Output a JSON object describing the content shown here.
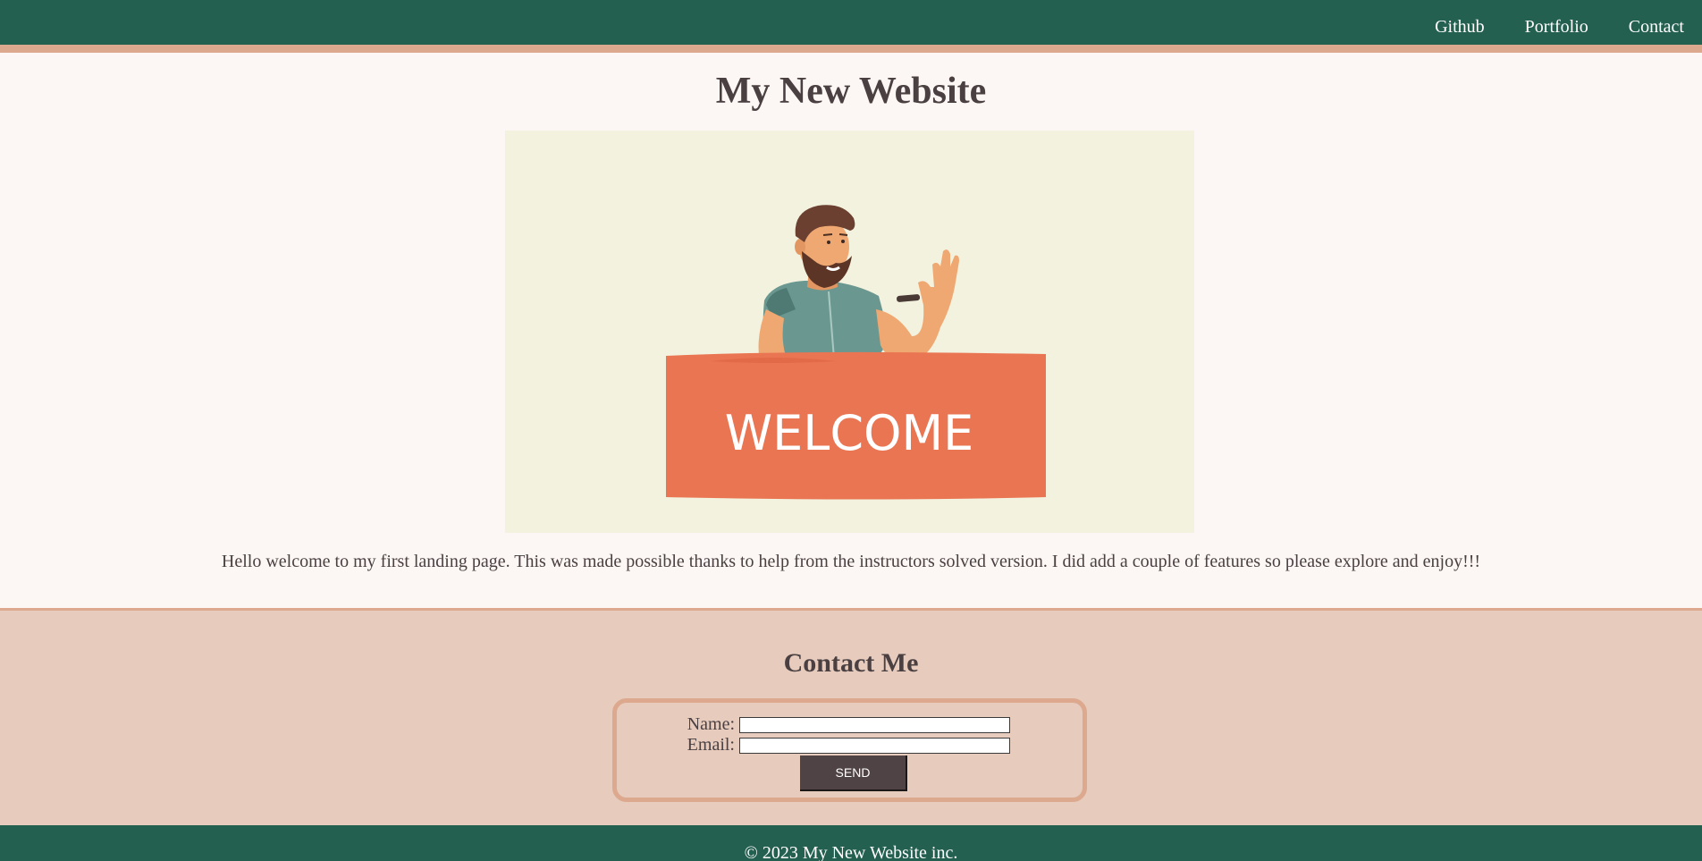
{
  "nav": {
    "items": [
      {
        "label": "Github"
      },
      {
        "label": "Portfolio"
      },
      {
        "label": "Contact"
      }
    ]
  },
  "hero": {
    "title": "My New Website",
    "banner_text": "WELCOME",
    "intro": "Hello welcome to my first landing page. This was made possible thanks to help from the instructors solved version. I did add a couple of features so please explore and enjoy!!!"
  },
  "contact": {
    "title": "Contact Me",
    "name_label": "Name:",
    "email_label": "Email:",
    "name_value": "",
    "email_value": "",
    "send_label": "SEND"
  },
  "footer": {
    "text": "© 2023 My New Website inc."
  },
  "colors": {
    "header_bg": "#246050",
    "accent_peach": "#dca98f",
    "page_bg": "#fcf7f4",
    "contact_bg": "#e7cbbd",
    "banner_orange": "#ea7552",
    "button_bg": "#504345"
  }
}
